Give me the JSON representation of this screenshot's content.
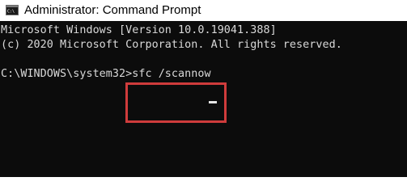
{
  "window": {
    "title": "Administrator: Command Prompt",
    "icon": "cmd-icon"
  },
  "console": {
    "lines": [
      "Microsoft Windows [Version 10.0.19041.388]",
      "(c) 2020 Microsoft Corporation. All rights reserved."
    ],
    "prompt": "C:\\WINDOWS\\system32>",
    "command": "sfc /scannow"
  },
  "colors": {
    "console_background": "#0c0c0c",
    "console_text": "#d9d9d9",
    "highlight": "#cf3c3c"
  }
}
